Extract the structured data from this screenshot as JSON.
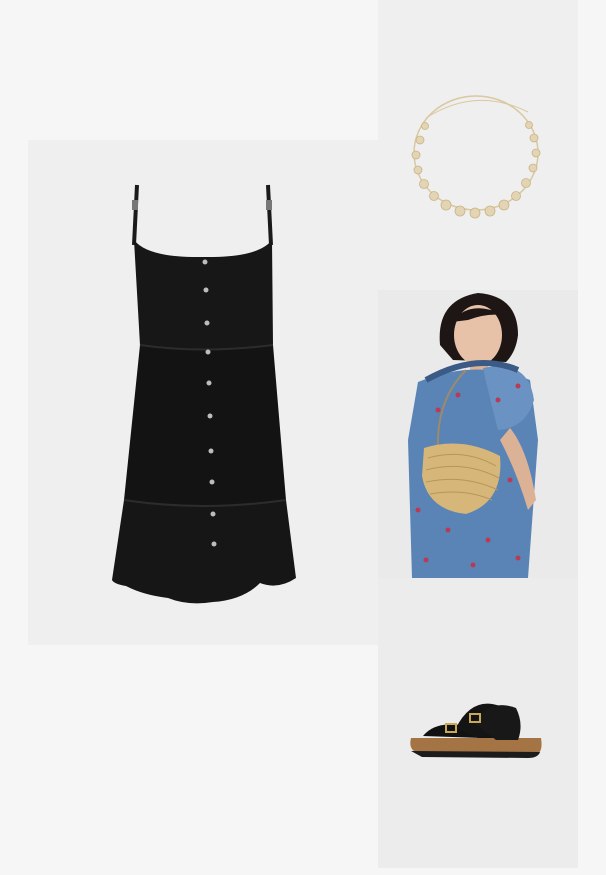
{
  "board": {
    "items": [
      {
        "key": "dress",
        "icon": "black-button-front-sundress"
      },
      {
        "key": "necklace",
        "icon": "gold-flower-chain-necklace"
      },
      {
        "key": "bag",
        "icon": "straw-crescent-crossbody-bag"
      },
      {
        "key": "sandals",
        "icon": "black-strap-cork-sandals"
      }
    ],
    "colors": {
      "background": "#f6f6f6",
      "dress": "#151515",
      "denim": "#5b86b8",
      "straw": "#d8b97c",
      "gold": "#d9c59a",
      "cork": "#a87848"
    }
  }
}
